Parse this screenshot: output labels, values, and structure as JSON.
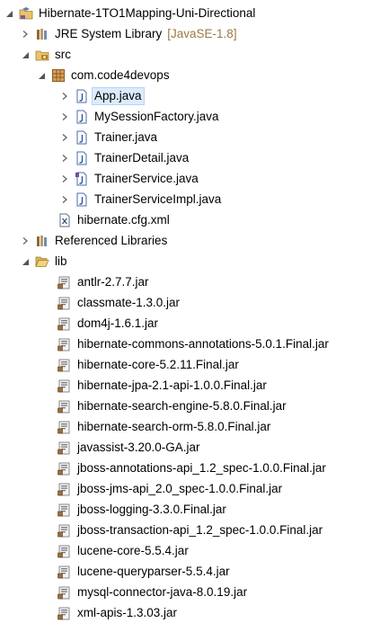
{
  "project": {
    "name": "Hibernate-1TO1Mapping-Uni-Directional",
    "icon": "java-project-icon",
    "expanded": true
  },
  "jre": {
    "label": "JRE System Library",
    "decoration": "[JavaSE-1.8]",
    "icon": "library-icon"
  },
  "src": {
    "label": "src",
    "icon": "source-folder-icon"
  },
  "package": {
    "label": "com.code4devops",
    "icon": "package-icon"
  },
  "java_files": [
    {
      "label": "App.java",
      "selected": true,
      "icon": "java-file-icon"
    },
    {
      "label": "MySessionFactory.java",
      "selected": false,
      "icon": "java-file-icon"
    },
    {
      "label": "Trainer.java",
      "selected": false,
      "icon": "java-file-icon"
    },
    {
      "label": "TrainerDetail.java",
      "selected": false,
      "icon": "java-file-icon"
    },
    {
      "label": "TrainerService.java",
      "selected": false,
      "icon": "java-interface-file-icon"
    },
    {
      "label": "TrainerServiceImpl.java",
      "selected": false,
      "icon": "java-file-icon"
    }
  ],
  "config_file": {
    "label": "hibernate.cfg.xml",
    "icon": "xml-file-icon"
  },
  "referenced_libraries": {
    "label": "Referenced Libraries",
    "icon": "library-icon"
  },
  "lib": {
    "label": "lib",
    "icon": "folder-icon"
  },
  "jars": [
    "antlr-2.7.7.jar",
    "classmate-1.3.0.jar",
    "dom4j-1.6.1.jar",
    "hibernate-commons-annotations-5.0.1.Final.jar",
    "hibernate-core-5.2.11.Final.jar",
    "hibernate-jpa-2.1-api-1.0.0.Final.jar",
    "hibernate-search-engine-5.8.0.Final.jar",
    "hibernate-search-orm-5.8.0.Final.jar",
    "javassist-3.20.0-GA.jar",
    "jboss-annotations-api_1.2_spec-1.0.0.Final.jar",
    "jboss-jms-api_2.0_spec-1.0.0.Final.jar",
    "jboss-logging-3.3.0.Final.jar",
    "jboss-transaction-api_1.2_spec-1.0.0.Final.jar",
    "lucene-core-5.5.4.jar",
    "lucene-queryparser-5.5.4.jar",
    "mysql-connector-java-8.0.19.jar",
    "xml-apis-1.3.03.jar"
  ],
  "colors": {
    "selection": "#dcebfc",
    "decoration": "#9a7a3f",
    "twisty": "#6b6b6b"
  }
}
